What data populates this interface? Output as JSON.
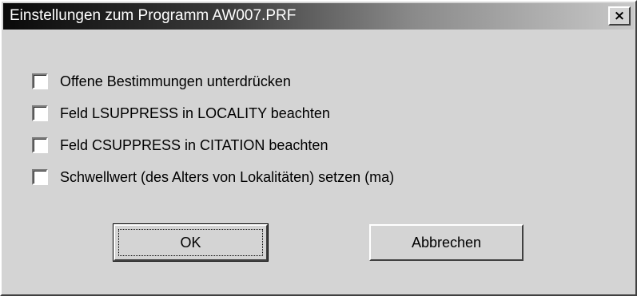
{
  "window": {
    "title": "Einstellungen zum Programm AW007.PRF",
    "close_glyph": "×"
  },
  "options": [
    {
      "label": "Offene Bestimmungen unterdrücken",
      "checked": false
    },
    {
      "label": "Feld LSUPPRESS in LOCALITY beachten",
      "checked": false
    },
    {
      "label": "Feld CSUPPRESS in CITATION beachten",
      "checked": false
    },
    {
      "label": "Schwellwert (des Alters von Lokalitäten) setzen (ma)",
      "checked": false
    }
  ],
  "buttons": {
    "ok_label": "OK",
    "cancel_label": "Abbrechen"
  },
  "colors": {
    "face": "#d4d4d4",
    "title_gradient_start": "#0a0a0a",
    "title_gradient_end": "#c8c8c8",
    "title_text": "#ffffff"
  }
}
